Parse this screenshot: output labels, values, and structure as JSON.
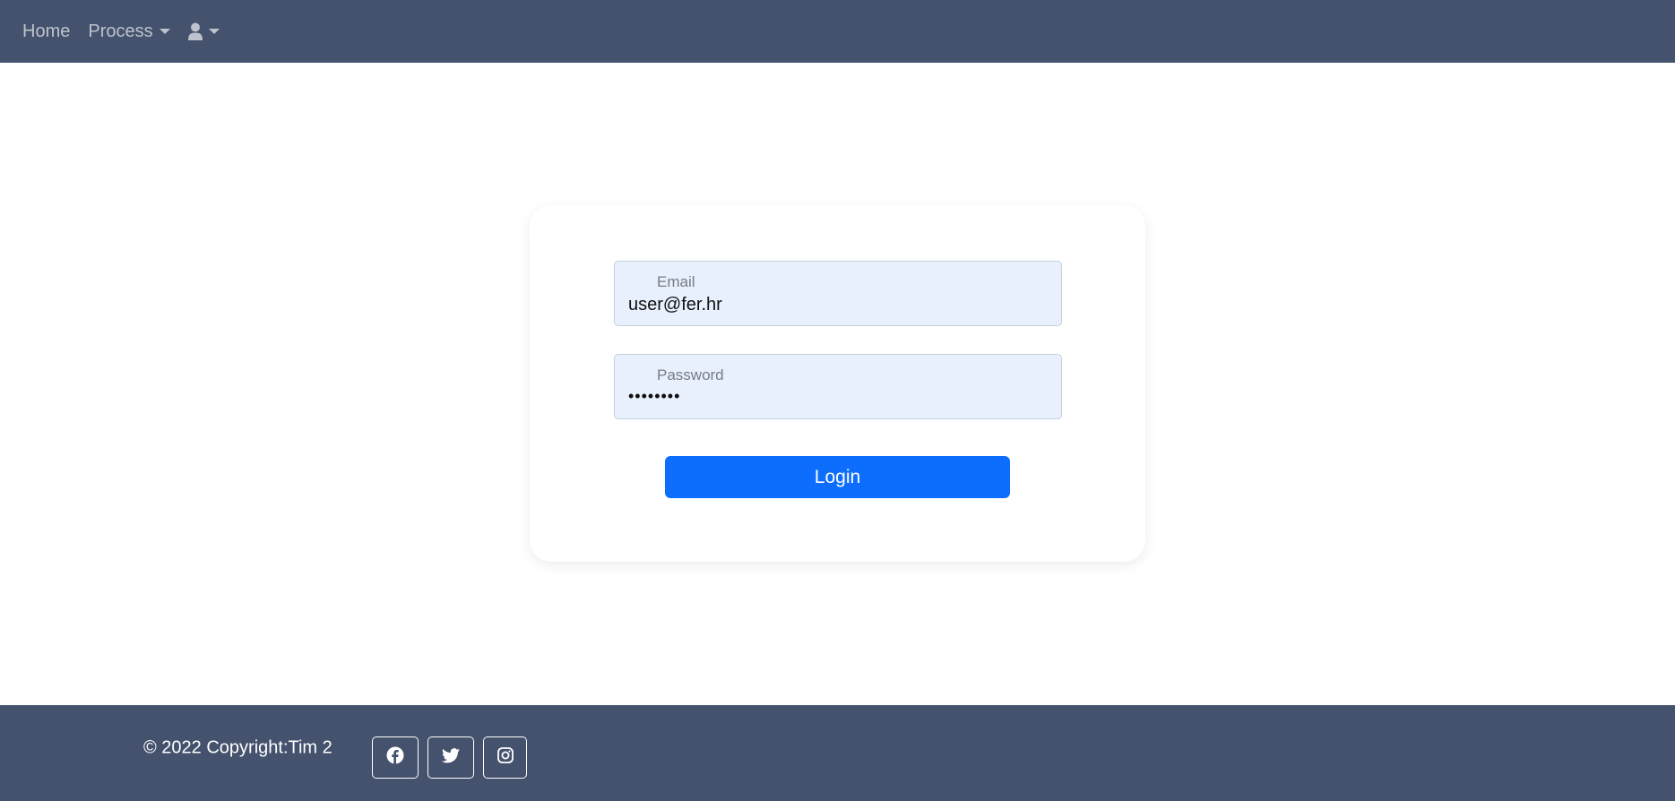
{
  "nav": {
    "home": "Home",
    "process": "Process"
  },
  "form": {
    "email_label": "Email",
    "email_value": "user@fer.hr",
    "password_label": "Password",
    "password_mask": "••••••••",
    "login_label": "Login"
  },
  "footer": {
    "copyright": "© 2022 Copyright:Tim 2"
  },
  "icons": {
    "user": "user-icon",
    "facebook": "facebook-icon",
    "twitter": "twitter-icon",
    "instagram": "instagram-icon"
  },
  "colors": {
    "navbar": "#44526d",
    "footer": "#44526d",
    "primary": "#0d6efd",
    "input_bg": "#e8f0fe"
  }
}
